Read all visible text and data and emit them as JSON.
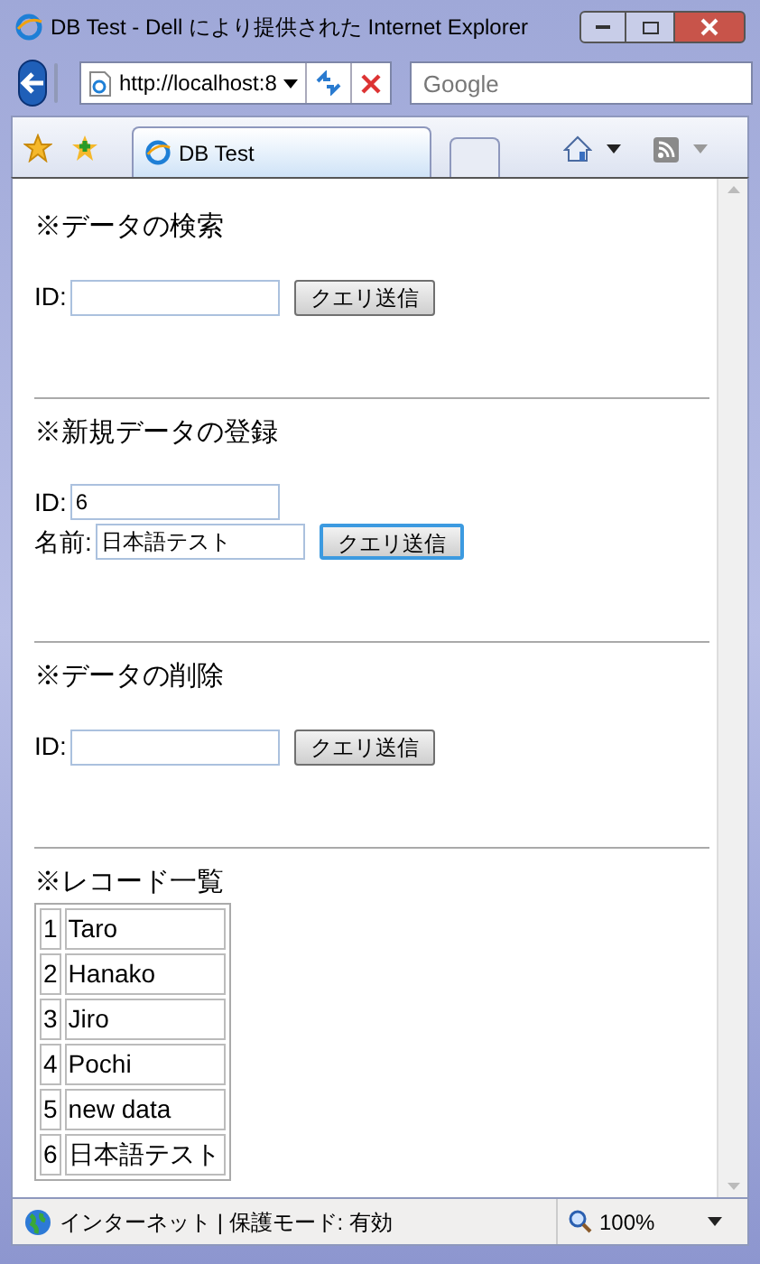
{
  "window": {
    "title": "DB Test - Dell により提供された Internet Explorer"
  },
  "address_bar": {
    "value": "http://localhost:8"
  },
  "search": {
    "placeholder": "Google"
  },
  "tabs": [
    {
      "label": "DB Test",
      "selected": true
    }
  ],
  "sections": [
    {
      "heading": "※データの検索",
      "fields": [
        {
          "label": "ID:"
        }
      ],
      "button": {
        "label": "クエリ送信",
        "focused": false
      }
    },
    {
      "heading": "※新規データの登録",
      "fields": [
        {
          "label": "ID:",
          "value": "6"
        },
        {
          "label": "名前:",
          "value": "日本語テスト"
        }
      ],
      "button": {
        "label": "クエリ送信",
        "focused": true
      }
    },
    {
      "heading": "※データの削除",
      "fields": [
        {
          "label": "ID:"
        }
      ],
      "button": {
        "label": "クエリ送信",
        "focused": false
      }
    }
  ],
  "records": {
    "heading": "※レコード一覧",
    "rows": [
      {
        "id": "1",
        "name": "Taro"
      },
      {
        "id": "2",
        "name": "Hanako"
      },
      {
        "id": "3",
        "name": "Jiro"
      },
      {
        "id": "4",
        "name": "Pochi"
      },
      {
        "id": "5",
        "name": "new data"
      },
      {
        "id": "6",
        "name": "日本語テスト"
      }
    ]
  },
  "status_bar": {
    "zone": "インターネット | 保護モード: 有効",
    "zoom": "100%"
  }
}
